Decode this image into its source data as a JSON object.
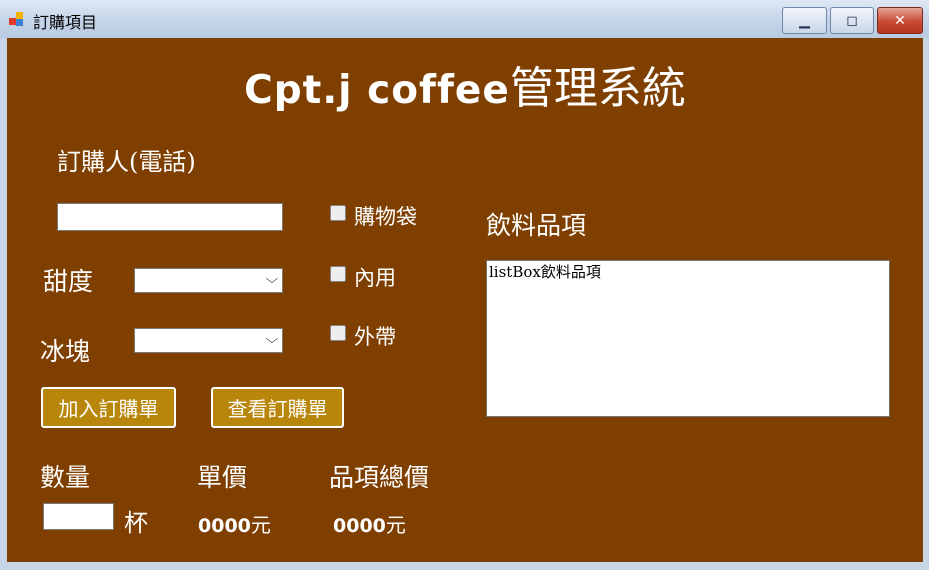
{
  "window": {
    "title": "訂購項目",
    "minimize_glyph": "▁",
    "maximize_glyph": "◻",
    "close_glyph": "✕"
  },
  "header": {
    "title_en": "Cpt.j coffee",
    "title_zh": "管理系統"
  },
  "order": {
    "customer_label": "訂購人(電話)",
    "customer_value": "",
    "sweetness_label": "甜度",
    "sweetness_value": "",
    "ice_label": "冰塊",
    "ice_value": "",
    "chevron": "⌵"
  },
  "options": {
    "bag_label": "購物袋",
    "dine_in_label": "內用",
    "takeout_label": "外帶",
    "bag_checked": false,
    "dine_in_checked": false,
    "takeout_checked": false
  },
  "actions": {
    "add_label": "加入訂購單",
    "view_label": "查看訂購單"
  },
  "summary": {
    "quantity_label": "數量",
    "quantity_value": "",
    "cup_unit": "杯",
    "unit_price_label": "單價",
    "unit_price_value": "0000",
    "total_label": "品項總價",
    "total_value": "0000",
    "currency": "元"
  },
  "drinks": {
    "label": "飲料品項",
    "items": [
      "listBox飲料品項"
    ]
  },
  "colors": {
    "background": "#7f3f00",
    "button": "#b8860b",
    "text": "#ffffff"
  }
}
